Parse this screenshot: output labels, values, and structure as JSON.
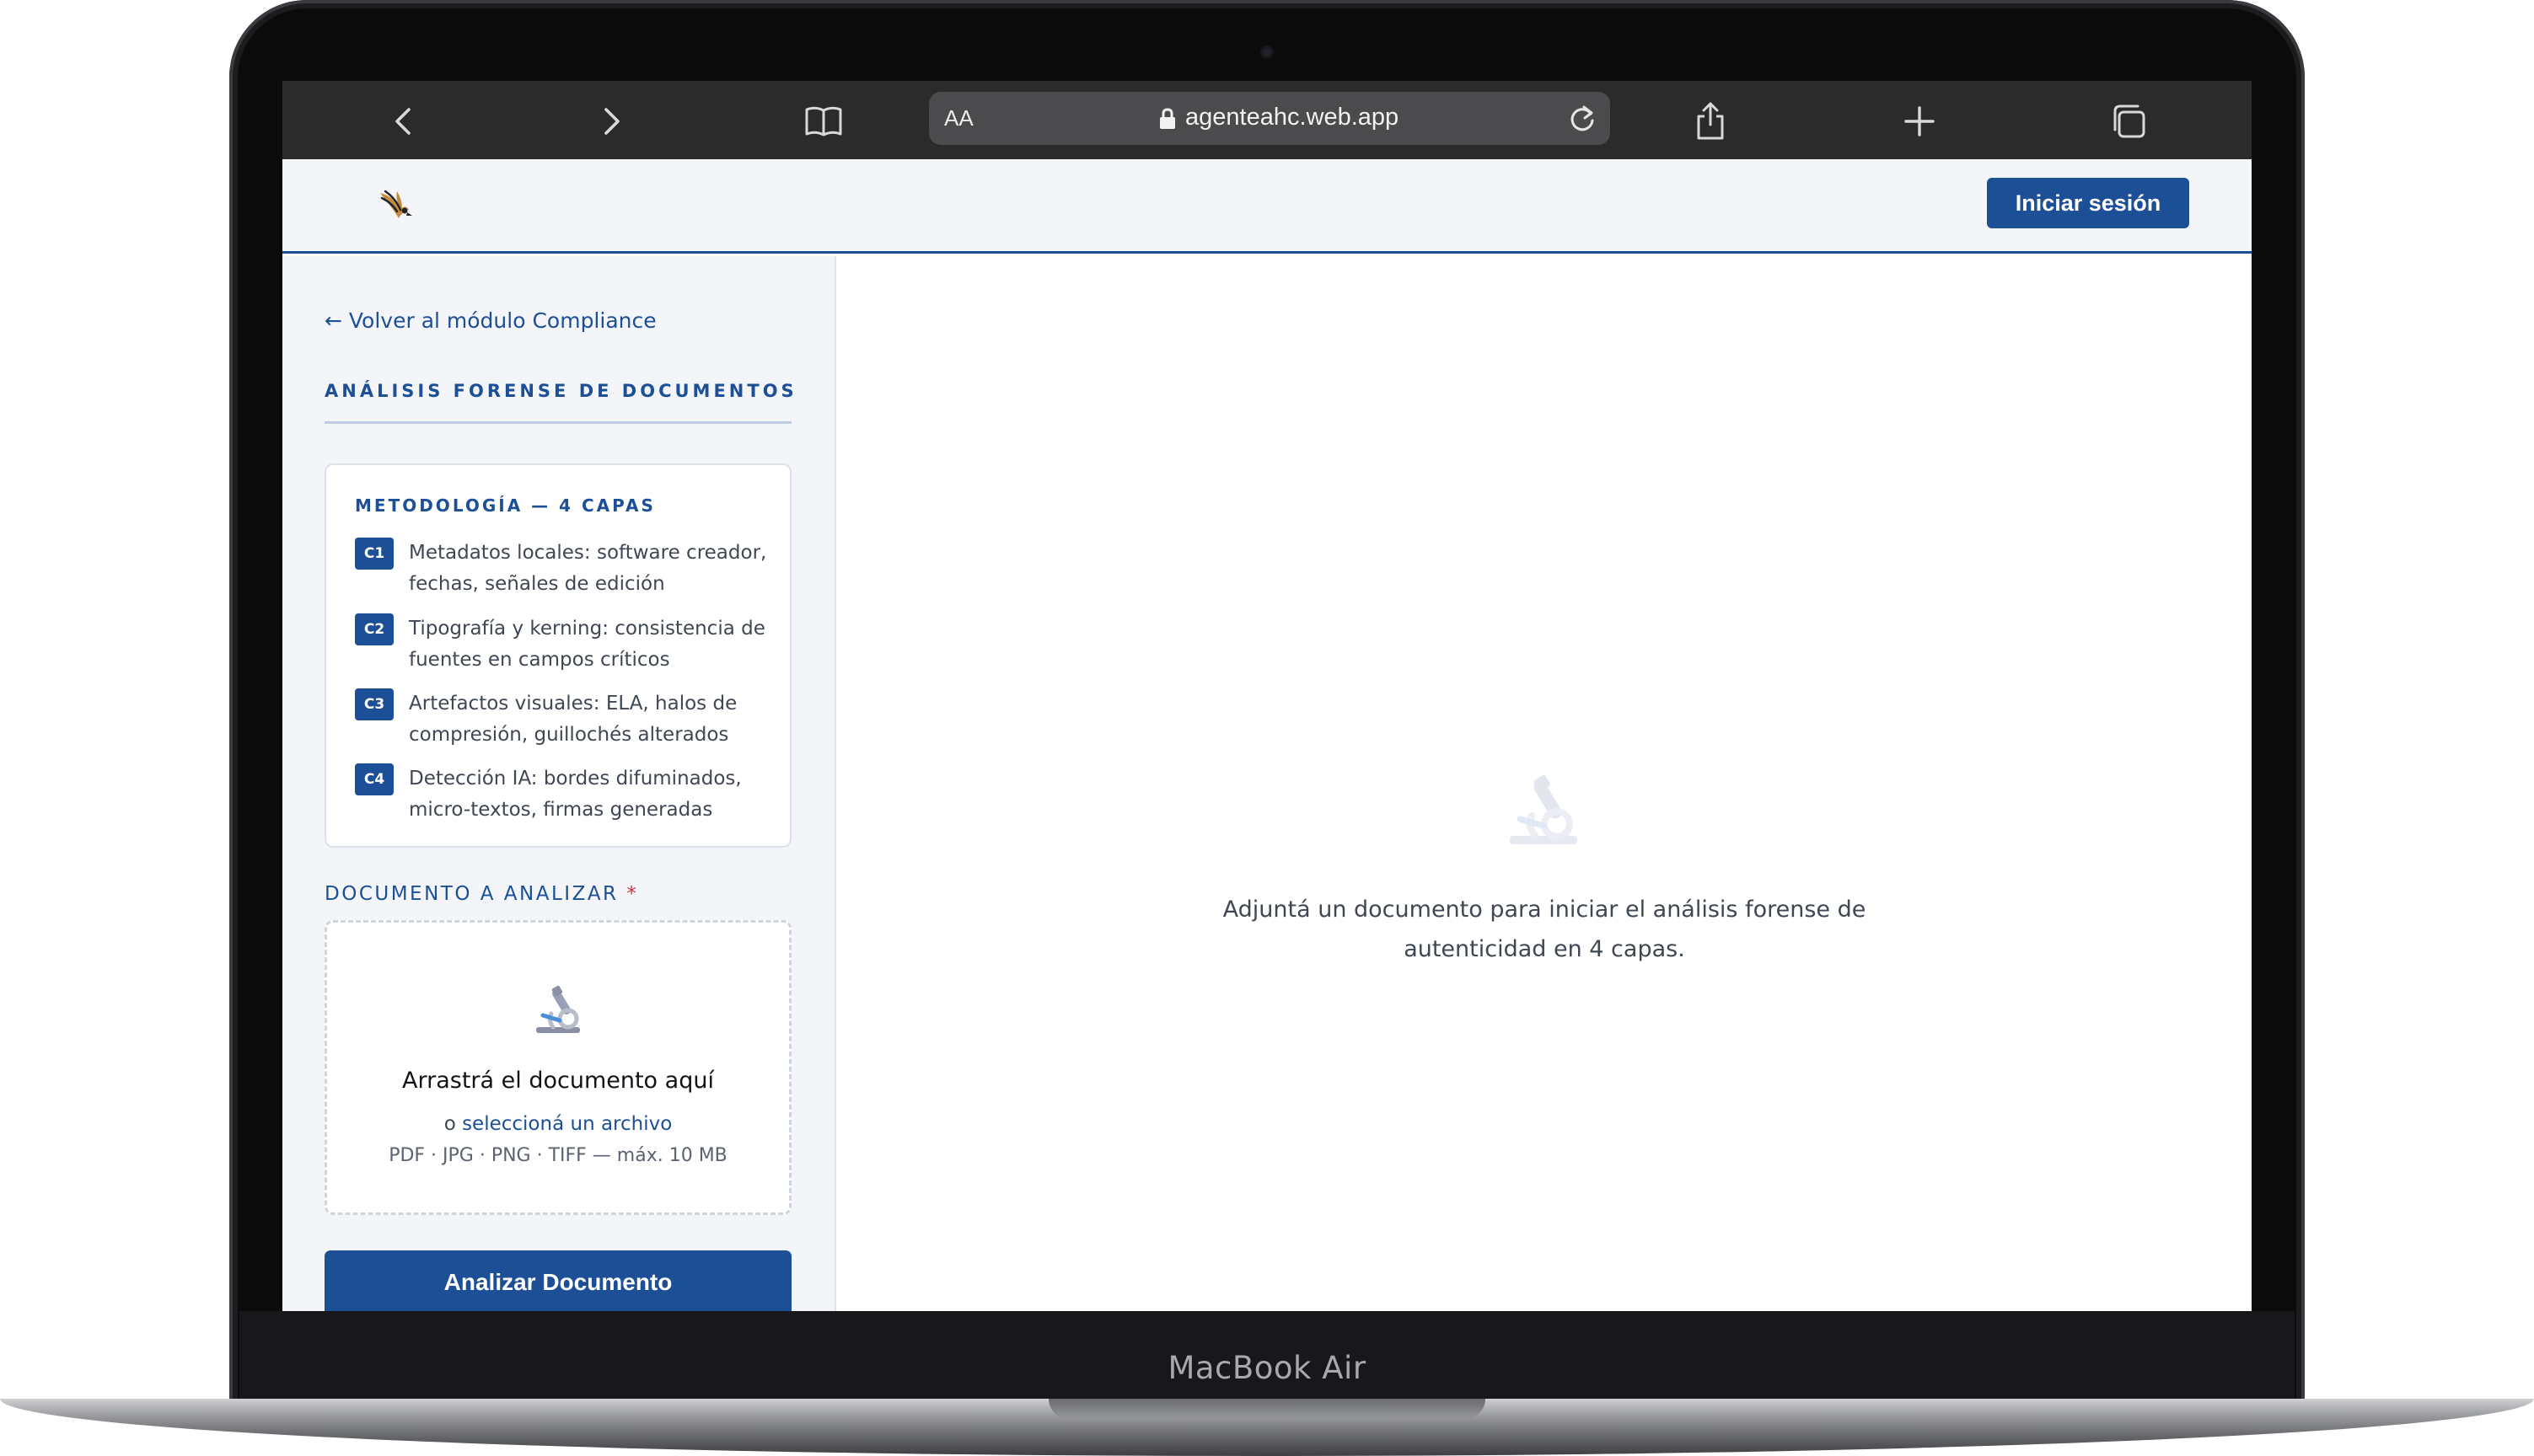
{
  "device": {
    "label": "MacBook Air"
  },
  "browser": {
    "text_size_label": "AA",
    "url": "agenteahc.web.app"
  },
  "header": {
    "logo_icon": "hawk-logo-icon",
    "login_label": "Iniciar sesión"
  },
  "sidebar": {
    "back_link": "← Volver al módulo Compliance",
    "section_title": "ANÁLISIS FORENSE DE DOCUMENTOS",
    "methodology": {
      "title": "METODOLOGÍA — 4 CAPAS",
      "layers": [
        {
          "badge": "C1",
          "text": "Metadatos locales: software creador, fechas, señales de edición"
        },
        {
          "badge": "C2",
          "text": "Tipografía y kerning: consistencia de fuentes en campos críticos"
        },
        {
          "badge": "C3",
          "text": "Artefactos visuales: ELA, halos de compresión, guillochés alterados"
        },
        {
          "badge": "C4",
          "text": "Detección IA: bordes difuminados, micro-textos, firmas generadas"
        }
      ]
    },
    "document_label": "DOCUMENTO A ANALIZAR",
    "required_mark": "*",
    "dropzone": {
      "icon": "microscope-icon",
      "title": "Arrastrá el documento aquí",
      "select_prefix": "o",
      "select_link": "seleccioná un archivo",
      "formats": "PDF · JPG · PNG · TIFF — máx. 10 MB"
    },
    "analyze_label": "Analizar Documento"
  },
  "main": {
    "empty_icon": "microscope-icon",
    "empty_text": "Adjuntá un documento para iniciar el análisis forense de autenticidad en 4 capas."
  },
  "colors": {
    "accent": "#1c4f96",
    "sidebar_bg": "#f3f5f9",
    "required": "#d33333"
  }
}
